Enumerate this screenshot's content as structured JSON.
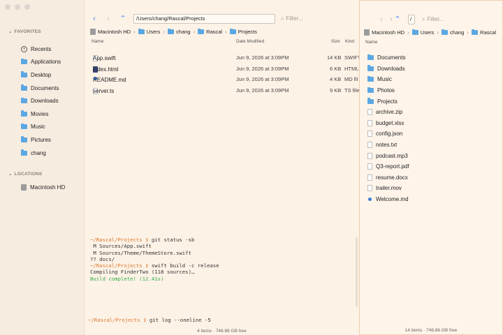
{
  "sidebar": {
    "favorites_title": "FAVORITES",
    "favorites": [
      {
        "label": "Recents",
        "icon": "clock-icon"
      },
      {
        "label": "Applications",
        "icon": "folder-icon"
      },
      {
        "label": "Desktop",
        "icon": "folder-icon"
      },
      {
        "label": "Documents",
        "icon": "folder-icon"
      },
      {
        "label": "Downloads",
        "icon": "folder-icon"
      },
      {
        "label": "Movies",
        "icon": "folder-icon"
      },
      {
        "label": "Music",
        "icon": "folder-icon"
      },
      {
        "label": "Pictures",
        "icon": "folder-icon"
      },
      {
        "label": "chang",
        "icon": "folder-icon"
      }
    ],
    "locations_title": "LOCATIONS",
    "locations": [
      {
        "label": "Macintosh HD",
        "icon": "disk-icon"
      }
    ]
  },
  "left": {
    "path": "/Users/chang/Rascal/Projects",
    "filter_placeholder": "Filter...",
    "breadcrumb": [
      "Macintosh HD",
      "Users",
      "chang",
      "Rascal",
      "Projects"
    ],
    "columns": {
      "name": "Name",
      "date": "Date Modified",
      "size": "Size",
      "kind": "Kind"
    },
    "files": [
      {
        "name": "App.swift",
        "date": "Jun 9, 2026 at 3:09PM",
        "size": "14 KB",
        "kind": "SWIFT"
      },
      {
        "name": "index.html",
        "date": "Jun 9, 2026 at 3:09PM",
        "size": "6 KB",
        "kind": "HTML"
      },
      {
        "name": "README.md",
        "date": "Jun 9, 2026 at 3:09PM",
        "size": "4 KB",
        "kind": "MD fil"
      },
      {
        "name": "server.ts",
        "date": "Jun 9, 2026 at 3:09PM",
        "size": "9 KB",
        "kind": "TS file"
      }
    ],
    "terminal": {
      "lines": [
        {
          "prompt": "~/Rascal/Projects ❯ ",
          "text": "git status -sb"
        },
        {
          "text": " M Sources/App.swift"
        },
        {
          "text": " M Sources/Theme/ThemeStore.swift"
        },
        {
          "text": "?? docs/"
        },
        {
          "prompt": "~/Rascal/Projects ❯ ",
          "text": "swift build -c release"
        },
        {
          "text": "Compiling FinderTwo (118 sources)…"
        },
        {
          "text": "Build complete! (12.41s)",
          "color": "green"
        }
      ],
      "input_prompt": "~/Rascal/Projects ❯ ",
      "input_text": "git log --oneline -5"
    },
    "status": "4 items · 746.86 GB free"
  },
  "right": {
    "path": "/",
    "filter_placeholder": "Filter...",
    "breadcrumb": [
      "Macintosh HD",
      "Users",
      "chang",
      "Rascal"
    ],
    "column_name": "Name",
    "items": [
      {
        "name": "Documents",
        "type": "folder"
      },
      {
        "name": "Downloads",
        "type": "folder"
      },
      {
        "name": "Music",
        "type": "folder"
      },
      {
        "name": "Photos",
        "type": "folder"
      },
      {
        "name": "Projects",
        "type": "folder"
      },
      {
        "name": "archive.zip",
        "type": "file"
      },
      {
        "name": "budget.xlsx",
        "type": "file"
      },
      {
        "name": "config.json",
        "type": "file"
      },
      {
        "name": "notes.txt",
        "type": "file"
      },
      {
        "name": "podcast.mp3",
        "type": "file"
      },
      {
        "name": "Q3-report.pdf",
        "type": "file"
      },
      {
        "name": "resume.docx",
        "type": "file"
      },
      {
        "name": "trailer.mov",
        "type": "file"
      },
      {
        "name": "Welcome.md",
        "type": "md"
      }
    ],
    "status": "14 items · 746.86 GB free"
  },
  "colors": {
    "accent": "#3b82f6",
    "folder": "#5ba7e2",
    "prompt": "#d9772a",
    "success": "#2fae46"
  }
}
